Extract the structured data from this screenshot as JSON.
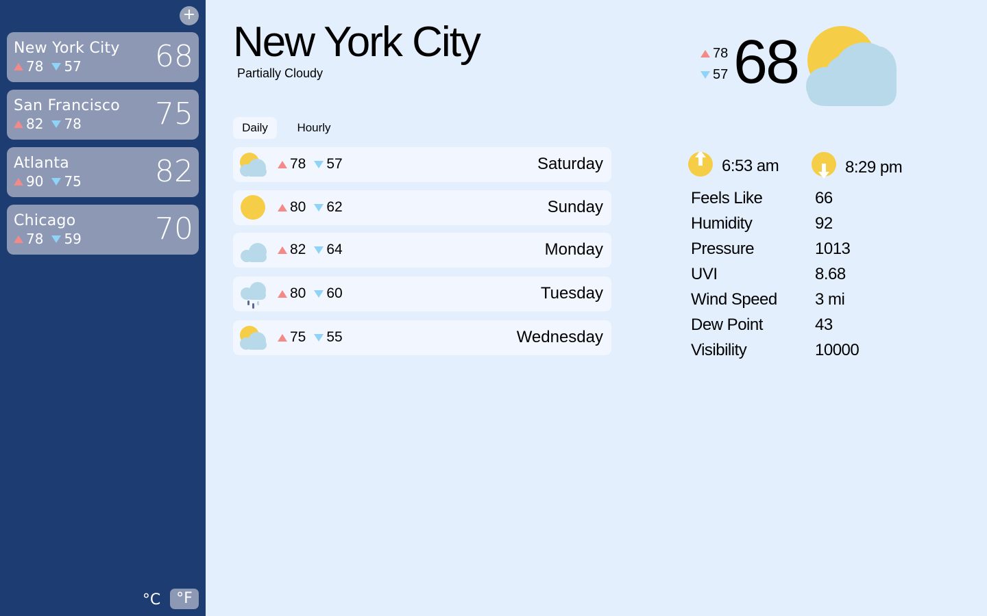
{
  "sidebar": {
    "add_label": "+",
    "cities": [
      {
        "name": "New York City",
        "hi": "78",
        "lo": "57",
        "temp": "68"
      },
      {
        "name": "San Francisco",
        "hi": "82",
        "lo": "78",
        "temp": "75"
      },
      {
        "name": "Atlanta",
        "hi": "90",
        "lo": "75",
        "temp": "82"
      },
      {
        "name": "Chicago",
        "hi": "78",
        "lo": "59",
        "temp": "70"
      }
    ],
    "unit_celsius": "°C",
    "unit_fahrenheit": "°F",
    "selected_unit": "°F"
  },
  "current": {
    "city": "New York City",
    "condition": "Partially Cloudy",
    "hi": "78",
    "lo": "57",
    "temp": "68",
    "icon": "partly-cloudy-icon"
  },
  "tabs": {
    "daily": "Daily",
    "hourly": "Hourly",
    "active": "Daily"
  },
  "forecast": [
    {
      "day": "Saturday",
      "hi": "78",
      "lo": "57",
      "icon": "partly-cloudy-icon"
    },
    {
      "day": "Sunday",
      "hi": "80",
      "lo": "62",
      "icon": "sun-icon"
    },
    {
      "day": "Monday",
      "hi": "82",
      "lo": "64",
      "icon": "cloud-icon"
    },
    {
      "day": "Tuesday",
      "hi": "80",
      "lo": "60",
      "icon": "rain-icon"
    },
    {
      "day": "Wednesday",
      "hi": "75",
      "lo": "55",
      "icon": "partly-cloudy-icon"
    }
  ],
  "sun": {
    "sunrise": "6:53 am",
    "sunset": "8:29 pm"
  },
  "details": [
    {
      "label": "Feels Like",
      "value": "66"
    },
    {
      "label": "Humidity",
      "value": "92"
    },
    {
      "label": "Pressure",
      "value": "1013"
    },
    {
      "label": "UVI",
      "value": "8.68"
    },
    {
      "label": "Wind Speed",
      "value": "3 mi"
    },
    {
      "label": "Dew Point",
      "value": "43"
    },
    {
      "label": "Visibility",
      "value": "10000"
    }
  ],
  "colors": {
    "sidebar_bg": "#1c3c72",
    "card_bg": "#8d98b4",
    "main_bg": "#e3effd",
    "row_bg": "#f2f7ff",
    "hi_arrow": "#f48a88",
    "lo_arrow": "#8fd3f7",
    "sun": "#f6cd46",
    "cloud": "#b8d9e9"
  }
}
